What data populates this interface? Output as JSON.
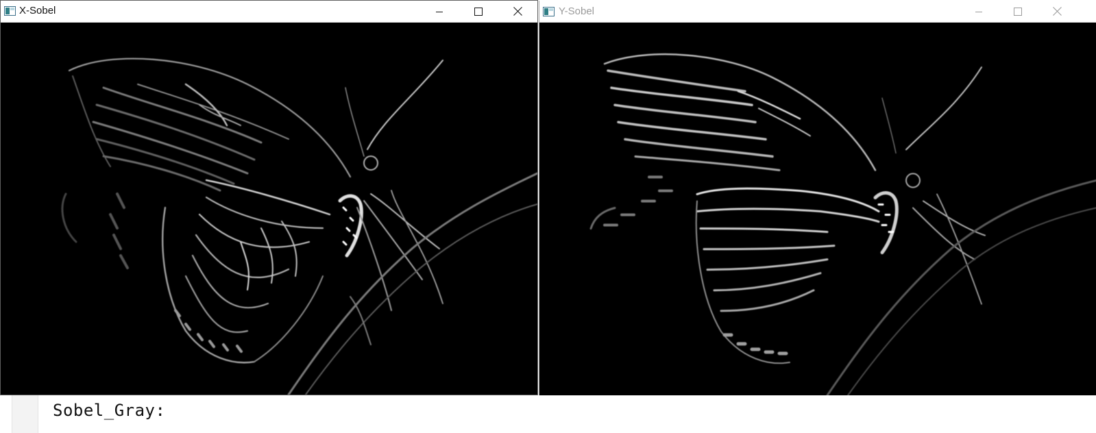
{
  "windows": [
    {
      "id": "x-sobel",
      "title": "X-Sobel",
      "active": true,
      "controls": [
        "minimize-icon",
        "maximize-icon",
        "close-icon"
      ]
    },
    {
      "id": "y-sobel",
      "title": "Y-Sobel",
      "active": false,
      "controls": [
        "minimize-icon",
        "maximize-icon",
        "close-icon"
      ]
    }
  ],
  "editor": {
    "code_line": "Sobel_Gray:"
  },
  "colors": {
    "image_background": "#000000",
    "edge_light": "#d8d8d8",
    "edge_dim": "#6a6a6a",
    "inactive_title": "#9a9a9a"
  }
}
